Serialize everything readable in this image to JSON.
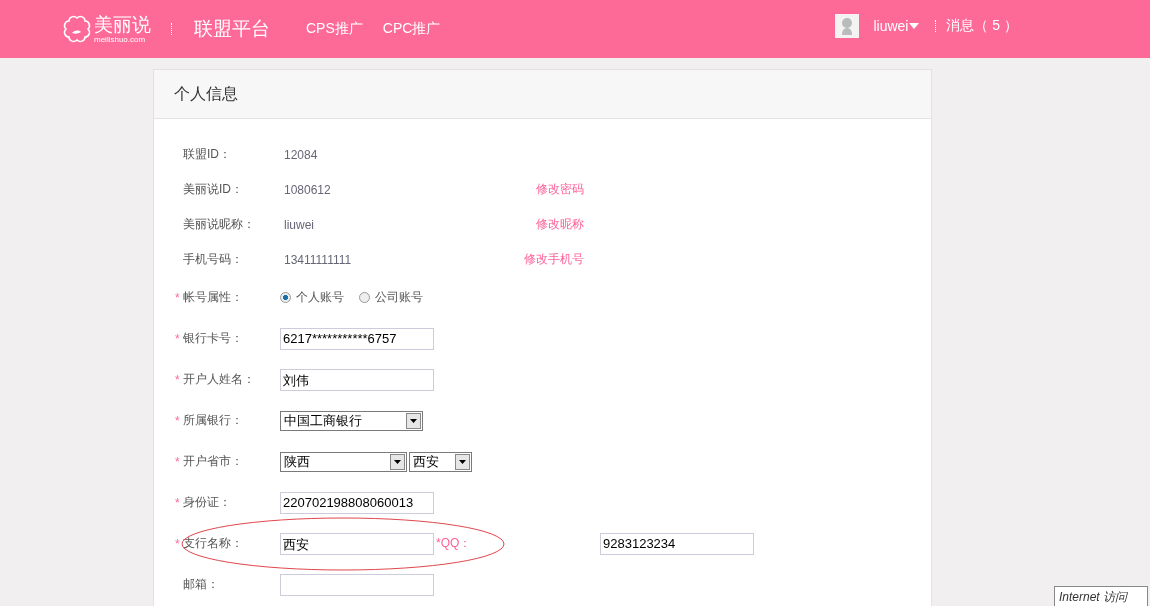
{
  "header": {
    "logo": {
      "name": "美丽说",
      "domain": "meilishuo.com"
    },
    "platform": "联盟平台",
    "nav": [
      "CPS推广",
      "CPC推广"
    ],
    "user": "liuwei",
    "messages": "消息（ 5 ）"
  },
  "card": {
    "title": "个人信息",
    "info_rows": [
      {
        "label": "联盟ID：",
        "value": "12084"
      },
      {
        "label": "美丽说ID：",
        "value": "1080612",
        "link": "修改密码"
      },
      {
        "label": "美丽说昵称：",
        "value": "liuwei",
        "link": "修改昵称"
      },
      {
        "label": "手机号码：",
        "value": "13411111111",
        "link": "修改手机号"
      }
    ],
    "form_rows": [
      {
        "kind": "radio",
        "required_mark": "*",
        "label": "帐号属性：",
        "options": [
          {
            "label": "个人账号",
            "selected": true
          },
          {
            "label": "公司账号",
            "selected": false
          }
        ]
      },
      {
        "kind": "text",
        "required_mark": "*",
        "label": "银行卡号：",
        "value": "6217***********6757"
      },
      {
        "kind": "text",
        "required_mark": "*",
        "label": "开户人姓名：",
        "value": "刘伟"
      },
      {
        "kind": "select",
        "required_mark": "*",
        "label": "所属银行：",
        "selects": [
          "中国工商银行"
        ]
      },
      {
        "kind": "select",
        "required_mark": "*",
        "label": "开户省市：",
        "selects": [
          "陕西",
          "西安"
        ]
      },
      {
        "kind": "text",
        "required_mark": "*",
        "label": "身份证：",
        "value": "220702198808060013"
      },
      {
        "kind": "text",
        "required_mark": "*",
        "label": "支行名称：",
        "value": "西安",
        "circled": true,
        "extra": {
          "label": "*QQ：",
          "value": "9283123234"
        }
      },
      {
        "kind": "text",
        "label": "邮箱："
      }
    ]
  },
  "tooltip": "Internet 访问"
}
